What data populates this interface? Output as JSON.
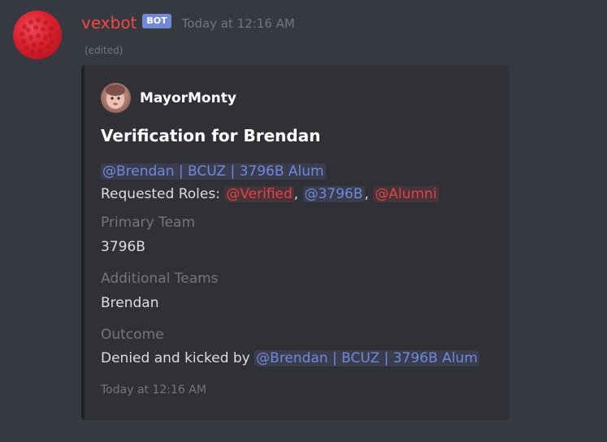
{
  "message": {
    "username": "vexbot",
    "bot_tag": "BOT",
    "timestamp": "Today at 12:16 AM",
    "edited": "(edited)",
    "username_color": "#f04747"
  },
  "embed": {
    "author": "MayorMonty",
    "title": "Verification for Brendan",
    "user_mention": "@Brendan | BCUZ | 3796B Alum",
    "requested_roles_label": "Requested Roles:",
    "roles": [
      {
        "name": "@Verified",
        "color": "#e2414a"
      },
      {
        "name": "@3796B",
        "color": "#7289da"
      },
      {
        "name": "@Alumni",
        "color": "#e2414a"
      }
    ],
    "fields": [
      {
        "name": "Primary Team",
        "value": "3796B"
      },
      {
        "name": "Additional Teams",
        "value": "Brendan"
      },
      {
        "name": "Outcome",
        "value_prefix": "Denied and kicked by",
        "value_mention": "@Brendan | BCUZ | 3796B Alum"
      }
    ],
    "footer": "Today at 12:16 AM"
  }
}
